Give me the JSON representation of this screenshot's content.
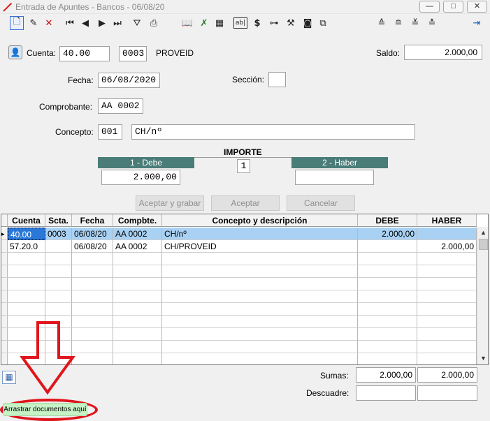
{
  "window": {
    "title": "Entrada de Apuntes - Bancos - 06/08/20",
    "min": "—",
    "max": "□",
    "close": "✕"
  },
  "header": {
    "cuenta_label": "Cuenta:",
    "cuenta_value": "40.00",
    "cuenta_code": "0003",
    "cuenta_name": "PROVEID",
    "saldo_label": "Saldo:",
    "saldo_value": "2.000,00",
    "fecha_label": "Fecha:",
    "fecha_value": "06/08/2020",
    "seccion_label": "Sección:",
    "seccion_value": "",
    "comprobante_label": "Comprobante:",
    "comprobante_value": "AA 0002",
    "concepto_label": "Concepto:",
    "concepto_code": "001",
    "concepto_value": "CH/nº"
  },
  "importe": {
    "title": "IMPORTE",
    "debe_label": "1 - Debe",
    "haber_label": "2 - Haber",
    "selector": "1",
    "debe_value": "2.000,00",
    "haber_value": ""
  },
  "buttons": {
    "accept_save": "Aceptar y grabar",
    "accept": "Aceptar",
    "cancel": "Cancelar"
  },
  "grid": {
    "columns": [
      "Cuenta",
      "Scta.",
      "Fecha",
      "Compbte.",
      "Concepto y descripción",
      "DEBE",
      "HABER"
    ],
    "rows": [
      [
        "40.00",
        "0003",
        "06/08/20",
        "AA 0002",
        "CH/nº",
        "2.000,00",
        ""
      ],
      [
        "57.20.0",
        "",
        "06/08/20",
        "AA 0002",
        "CH/PROVEID",
        "",
        "2.000,00"
      ]
    ]
  },
  "footer": {
    "sumas_label": "Sumas:",
    "sumas_debe": "2.000,00",
    "sumas_haber": "2.000,00",
    "descuadre_label": "Descuadre:",
    "descuadre_debe": "",
    "descuadre_haber": "",
    "drop_label": "Arrastrar documentos aquí"
  },
  "colors": {
    "accent_header": "#4a7c78",
    "selected_row": "#a9d1f3",
    "annotation": "#e0151c",
    "drop_zone": "#c6f2c6"
  }
}
